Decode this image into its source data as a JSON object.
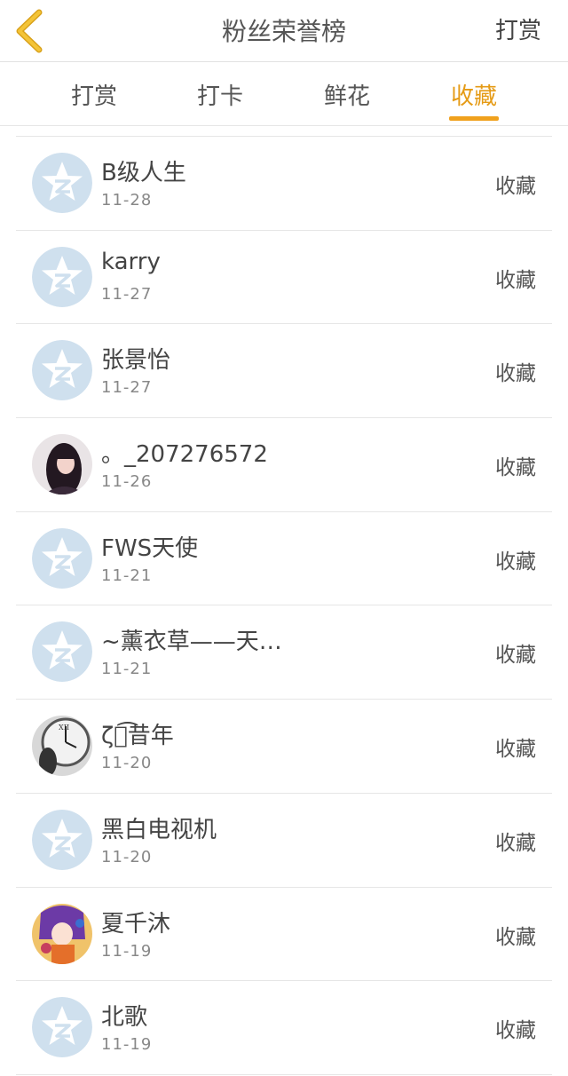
{
  "header": {
    "title": "粉丝荣誉榜",
    "right_action": "打赏"
  },
  "tabs": [
    {
      "label": "打赏",
      "active": false
    },
    {
      "label": "打卡",
      "active": false
    },
    {
      "label": "鲜花",
      "active": false
    },
    {
      "label": "收藏",
      "active": true
    }
  ],
  "colors": {
    "accent": "#f0a11d",
    "active_tab_text": "#e59b16",
    "default_avatar": "#cfe0ee"
  },
  "fans": [
    {
      "name": "B级人生",
      "date": "11-28",
      "action": "收藏",
      "avatar": "default-avatar-icon"
    },
    {
      "name": "karry",
      "date": "11-27",
      "action": "收藏",
      "avatar": "default-avatar-icon"
    },
    {
      "name": "张景怡",
      "date": "11-27",
      "action": "收藏",
      "avatar": "default-avatar-icon"
    },
    {
      "name": "。_207276572",
      "date": "11-26",
      "action": "收藏",
      "avatar": "girl-photo-avatar"
    },
    {
      "name": "FWS天使",
      "date": "11-21",
      "action": "收藏",
      "avatar": "default-avatar-icon"
    },
    {
      "name": "~薰衣草——天…",
      "date": "11-21",
      "action": "收藏",
      "avatar": "default-avatar-icon"
    },
    {
      "name": "ζั͡昔年",
      "date": "11-20",
      "action": "收藏",
      "avatar": "clock-photo-avatar"
    },
    {
      "name": "黑白电视机",
      "date": "11-20",
      "action": "收藏",
      "avatar": "default-avatar-icon"
    },
    {
      "name": "夏千沐",
      "date": "11-19",
      "action": "收藏",
      "avatar": "anime-avatar"
    },
    {
      "name": "北歌",
      "date": "11-19",
      "action": "收藏",
      "avatar": "default-avatar-icon"
    }
  ]
}
